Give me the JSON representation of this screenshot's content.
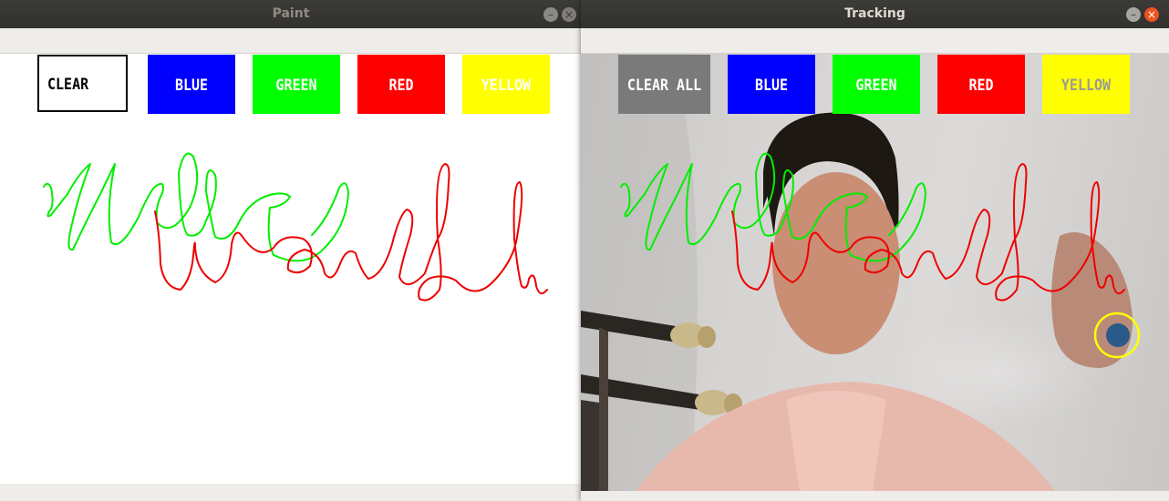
{
  "windows": {
    "paint": {
      "title": "Paint"
    },
    "tracking": {
      "title": "Tracking"
    }
  },
  "window_controls": {
    "minimize": "–",
    "close": "×"
  },
  "paint_buttons": [
    {
      "label": "CLEAR",
      "color": "#ffffff",
      "text_color": "#000000"
    },
    {
      "label": "BLUE",
      "color": "#0000ff",
      "text_color": "#ffffff"
    },
    {
      "label": "GREEN",
      "color": "#00ff00",
      "text_color": "#ffffff"
    },
    {
      "label": "RED",
      "color": "#ff0000",
      "text_color": "#ffffff"
    },
    {
      "label": "YELLOW",
      "color": "#ffff00",
      "text_color": "#ffffff"
    }
  ],
  "tracking_buttons": [
    {
      "label": "CLEAR ALL",
      "color": "#7a7a7a",
      "text_color": "#ffffff"
    },
    {
      "label": "BLUE",
      "color": "#0000ff",
      "text_color": "#ffffff"
    },
    {
      "label": "GREEN",
      "color": "#00ff00",
      "text_color": "#ffffff"
    },
    {
      "label": "RED",
      "color": "#ff0000",
      "text_color": "#ffffff"
    },
    {
      "label": "YELLOW",
      "color": "#ffff00",
      "text_color": "#9a9a9a"
    }
  ],
  "drawing": {
    "stroke_colors": {
      "line1": "#00ee00",
      "line2": "#ee0000"
    },
    "tracker_ring_color": "#ffff00"
  }
}
